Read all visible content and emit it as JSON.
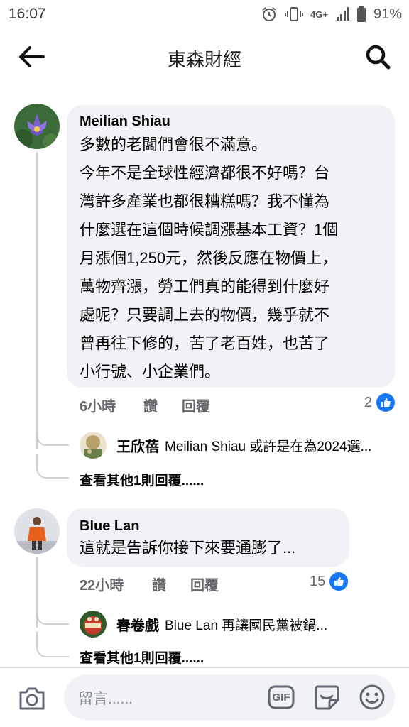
{
  "status_bar": {
    "time": "16:07",
    "network_label": "4G+",
    "battery_percent": "91%",
    "icons": [
      "alarm-icon",
      "vibrate-icon",
      "network-4g-icon",
      "signal-icon",
      "battery-icon"
    ]
  },
  "header": {
    "title": "東森財經",
    "back_icon": "back-arrow-icon",
    "search_icon": "search-icon"
  },
  "comments": [
    {
      "author": "Meilian Shiau",
      "text_lines": [
        "多數的老闆們會很不滿意。",
        "今年不是全球性經濟都很不好嗎？台",
        "灣許多產業也都很糟糕嗎？我不懂為",
        "什麼選在這個時候調漲基本工資？1個",
        "月漲個1,250元，然後反應在物價上，",
        "萬物齊漲，勞工們真的能得到什麼好",
        "處呢？只要調上去的物價，幾乎就不",
        "曾再往下修的，苦了老百姓，也苦了",
        "小行號、小企業們。"
      ],
      "time": "6小時",
      "like_label": "讚",
      "reply_label": "回覆",
      "like_count": "2",
      "reply_preview": {
        "author": "王欣蓓",
        "text": "Meilian Shiau 或許是在為2024選..."
      },
      "more_replies": "查看其他1則回覆......"
    },
    {
      "author": "Blue Lan",
      "text_lines": [
        "這就是告訴你接下來要通膨了..."
      ],
      "time": "22小時",
      "like_label": "讚",
      "reply_label": "回覆",
      "like_count": "15",
      "reply_preview": {
        "author": "春卷戲",
        "text": "Blue Lan 再讓國民黨被鍋..."
      },
      "more_replies": "查看其他1則回覆......"
    }
  ],
  "composer": {
    "placeholder": "留言......",
    "gif_label": "GIF",
    "icons": [
      "camera-icon",
      "gif-icon",
      "sticker-icon",
      "emoji-icon"
    ]
  },
  "colors": {
    "accent": "#1877f2",
    "bubble": "#f0f2f5",
    "secondary_text": "#65676b"
  }
}
